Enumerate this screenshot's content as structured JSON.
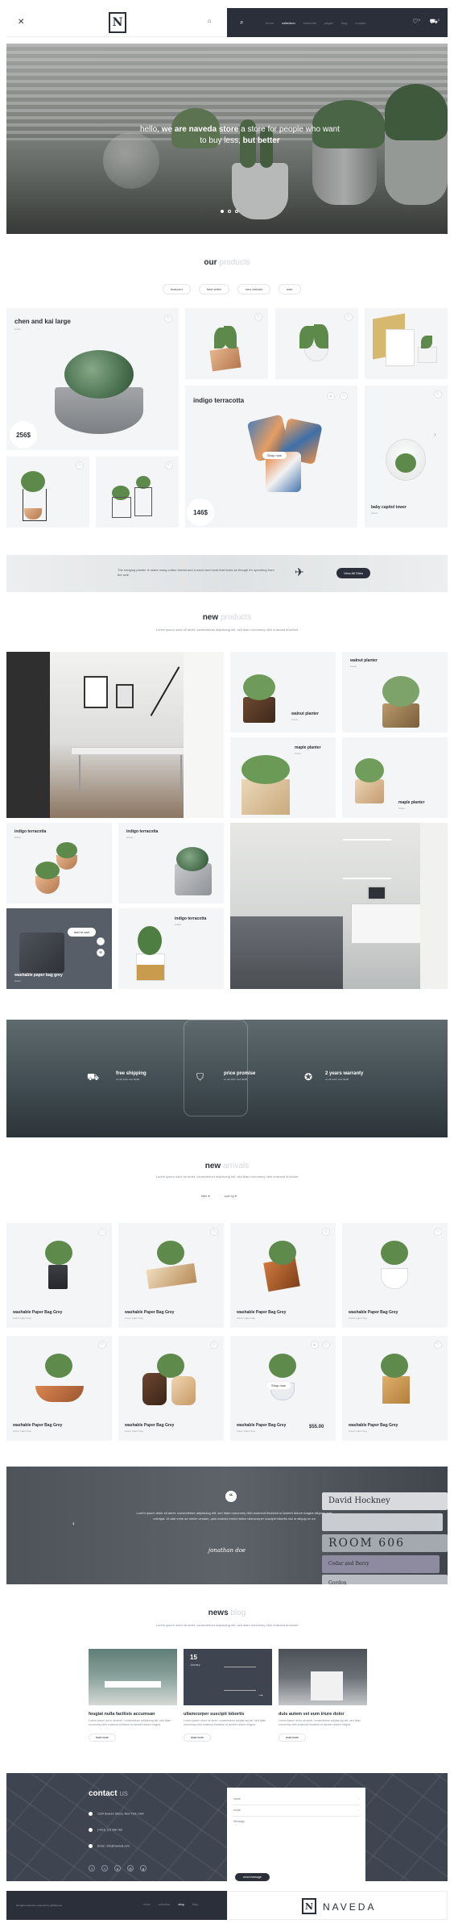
{
  "header": {
    "logo_letter": "N",
    "nav": [
      "home",
      "collection",
      "elements",
      "pages",
      "blog",
      "contact"
    ],
    "active_nav": "collection",
    "wishlist_count": "0",
    "cart_count": "0"
  },
  "hero": {
    "text_pre": "hello, ",
    "text_bold": "we are naveda store",
    "text_mid": " a store for people who want",
    "text_line2": "to buy less, ",
    "text_bold2": "but better"
  },
  "our_products": {
    "title_bold": "our",
    "title_light": "products",
    "tabs": [
      "featured",
      "best seller",
      "new arrivals",
      "sale"
    ],
    "cards": {
      "chen": {
        "title": "chen and kai large",
        "sub": "indoor",
        "price": "256$"
      },
      "indigo": {
        "title": "indigo terracotta",
        "price": "146$",
        "badge": "Shop now"
      },
      "baby": {
        "title": "baby capitol tower",
        "sub": "indoor"
      }
    }
  },
  "banner": {
    "text": "The hanging planter is made using cotton thread and a wood and hook that looks as though it's sprouting from the wall.",
    "button": "View All Sites"
  },
  "new_products": {
    "title_bold": "new",
    "title_light": "products",
    "subtitle": "Lorem ipsum dolor sit amet, consectetuer adipiscing elit, sed diam nonummy nibh euismod tincidunt",
    "cards": {
      "walnut1": "walnut planter",
      "walnut2": "walnut planter",
      "maple1": "maple planter",
      "maple2": "maple planter",
      "indigo1": "indigo terracotta",
      "indigo2": "indigo terracotta",
      "indigo3": "indigo terracotta",
      "washable": "washable paper bag grey",
      "add_to_cart": "add to cart",
      "sub": "indoor"
    }
  },
  "features": [
    {
      "title": "free shipping",
      "sub": "on all order over $100"
    },
    {
      "title": "price promise",
      "sub": "on all order over $100"
    },
    {
      "title": "2 years warranty",
      "sub": "on all order over $100"
    }
  ],
  "new_arrivals": {
    "title_bold": "new",
    "title_light": "arrivals",
    "subtitle": "Lorem ipsum dolor sit amet, consectetuer adipiscing elit, sed diam nonummy nibh euismod tincidunt",
    "filter": "filter",
    "sort": "sort by",
    "item_title": "washable Paper Bag Grey",
    "item_sub": "indoor paper bag",
    "price": "$55.00",
    "badge": "Shop now"
  },
  "testimonial": {
    "quote": "Lorem ipsum dolor sit amet, consectetuer adipiscing elit, sed diam nonummy nibh euismod tincidunt ut laoreet dolore magna aliquam erat volutpat. Ut wisi enim ad minim veniam, quis nostrud exerci tation ullamcorper suscipit lobortis nisl ut aliquip ex ea",
    "name": "jonathan doe",
    "books": [
      "David Hockney",
      "ROOM 606",
      "Cedar and Berry",
      "Gordon"
    ]
  },
  "news": {
    "title_bold": "news",
    "title_light": "blog",
    "subtitle": "Lorem ipsum dolor sit amet, consectetuer adipiscing elit, sed diam nonummy nibh euismod tincidunt",
    "items": [
      {
        "title": "feugiat nulla facilisis accumsan",
        "desc": "Lorem ipsum dolor sit amet, consectetuer adipiscing elit, sed diam nonummy nibh euismod tincidunt ut laoreet dolore magna",
        "more": "read more"
      },
      {
        "title": "ullamcorper suscipit lobortis",
        "desc": "Lorem ipsum dolor sit amet, consectetuer adipiscing elit, sed diam nonummy nibh euismod tincidunt ut laoreet dolore magna",
        "more": "read more",
        "date": "15",
        "month": "January"
      },
      {
        "title": "duis autem vel eum iriure dolor",
        "desc": "Lorem ipsum dolor sit amet, consectetuer adipiscing elit, sed diam nonummy nibh euismod tincidunt ut laoreet dolore magna",
        "more": "read more"
      }
    ]
  },
  "contact": {
    "title_bold": "contact",
    "title_light": "us",
    "address": "1234 Heaven Stress, New York, USA",
    "phone": "(+001) 123 456 789",
    "email": "Email : info@naveda.com",
    "form": {
      "name": "name",
      "email": "email",
      "message": "Message",
      "send": "send message"
    }
  },
  "footer": {
    "copyright": "All rights reserved, powered by gridthemes",
    "links": [
      "home",
      "collection",
      "shop",
      "blog"
    ],
    "active_link": "shop",
    "brand": "NAVEDA",
    "logo_letter": "N"
  },
  "colors": {
    "dark": "#2a2f3a",
    "light": "#f4f5f6",
    "accent": "#2a2e35"
  }
}
